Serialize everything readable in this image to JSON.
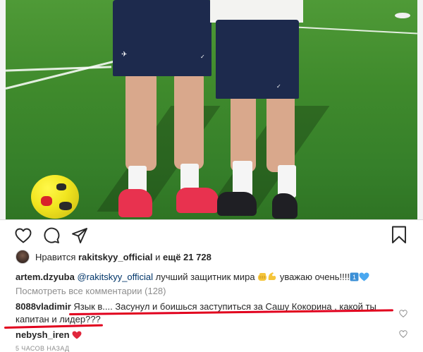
{
  "post": {
    "photo_alt": ""
  },
  "actions": {
    "like_icon": "heart-icon",
    "comment_icon": "comment-icon",
    "share_icon": "share-icon",
    "save_icon": "bookmark-icon"
  },
  "likes": {
    "prefix": "Нравится ",
    "user": "rakitskyy_official",
    "middle": " и ",
    "count": "ещё 21 728"
  },
  "caption": {
    "author": "artem.dzyuba",
    "mention": "@rakitskyy_official",
    "text": " лучший защитник мира ",
    "text2": " уважаю очень!!!!"
  },
  "view_all": "Посмотреть все комментарии (128)",
  "comments": [
    {
      "author": "8088vladimir",
      "text": "Язык в.... Засунул и боишься заступиться за Сашу Кокорина , какой ты капитан и лидер???"
    },
    {
      "author": "nebysh_iren",
      "text": ""
    }
  ],
  "timestamp": "5 ЧАСОВ НАЗАД",
  "colors": {
    "annotation": "#e1001d",
    "text": "#262626",
    "muted": "#8e8e8e"
  }
}
